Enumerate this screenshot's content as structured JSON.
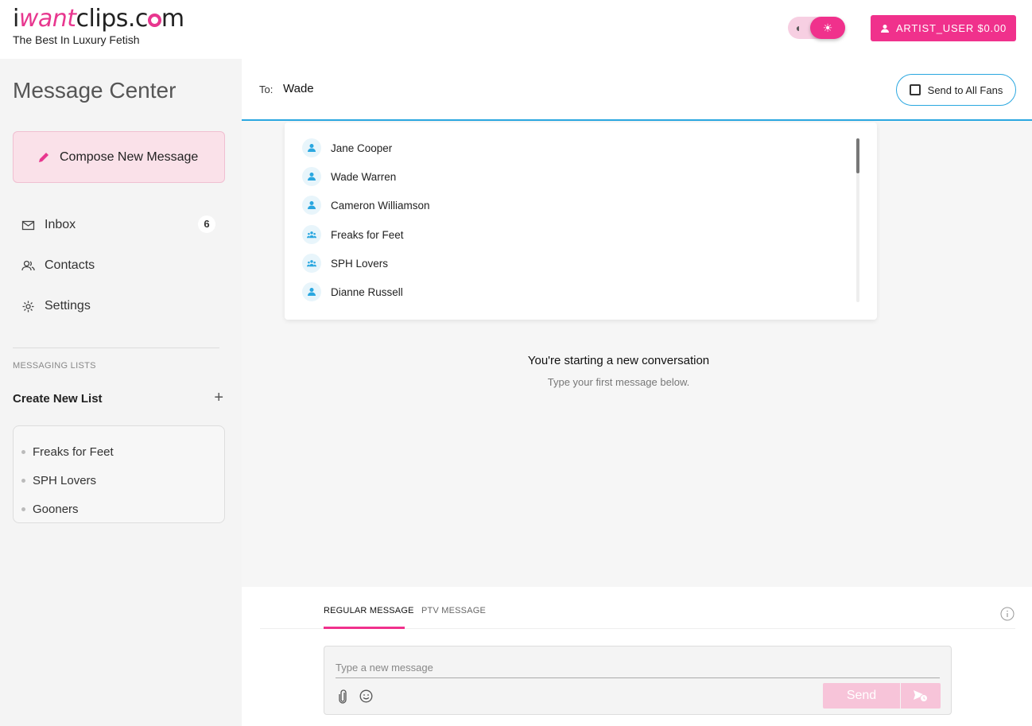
{
  "header": {
    "logo_prefix": "i",
    "logo_pink": "want",
    "logo_mid": "clips.c",
    "logo_end": "m",
    "tagline": "The Best In Luxury Fetish",
    "user_button": "ARTIST_USER $0.00",
    "brand_color": "#f0318c"
  },
  "sidebar": {
    "title": "Message Center",
    "compose_label": "Compose New Message",
    "nav": {
      "inbox": {
        "label": "Inbox",
        "count": "6"
      },
      "contacts": {
        "label": "Contacts"
      },
      "settings": {
        "label": "Settings"
      }
    },
    "lists_label": "MESSAGING LISTS",
    "create_list": "Create New List",
    "create_plus": "+",
    "lists": [
      "Freaks for Feet",
      "SPH Lovers",
      "Gooners"
    ]
  },
  "main": {
    "to_label": "To:",
    "to_value": "Wade",
    "send_all_label": "Send to All Fans",
    "suggestions": [
      {
        "name": "Jane Cooper",
        "icon": "user-icon"
      },
      {
        "name": "Wade Warren",
        "icon": "user-icon"
      },
      {
        "name": "Cameron Williamson",
        "icon": "user-icon"
      },
      {
        "name": "Freaks for Feet",
        "icon": "group-icon"
      },
      {
        "name": "SPH Lovers",
        "icon": "group-icon"
      },
      {
        "name": "Dianne Russell",
        "icon": "user-icon"
      }
    ],
    "empty_title": "You're starting a new conversation",
    "empty_subtitle": "Type your first message below.",
    "tabs": {
      "regular": "REGULAR MESSAGE",
      "ptv": "PTV MESSAGE"
    },
    "message_placeholder": "Type a new message",
    "send_label": "Send",
    "accent_color": "#2aa7e0"
  }
}
